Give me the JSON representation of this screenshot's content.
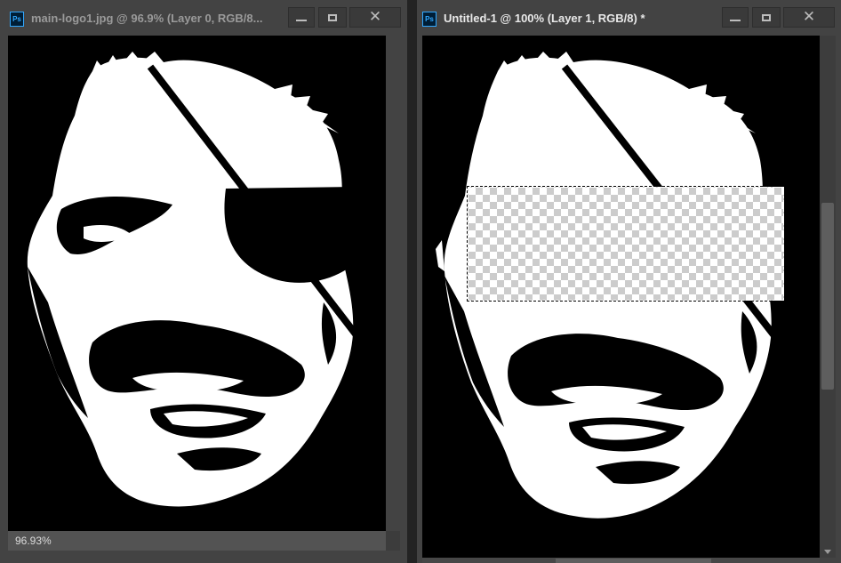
{
  "left_document": {
    "title": "main-logo1.jpg @ 96.9% (Layer 0, RGB/8...",
    "status_zoom": "96.93%",
    "window_buttons": {
      "minimize": "minimize-icon",
      "maximize": "maximize-icon",
      "close": "close-icon"
    }
  },
  "right_document": {
    "title": "Untitled-1 @ 100% (Layer 1, RGB/8) *",
    "window_buttons": {
      "minimize": "minimize-icon",
      "maximize": "maximize-icon",
      "close": "close-icon"
    }
  },
  "app_icon_label": "Ps",
  "colors": {
    "panel": "#434343",
    "canvas": "#000000",
    "artwork": "#ffffff"
  }
}
